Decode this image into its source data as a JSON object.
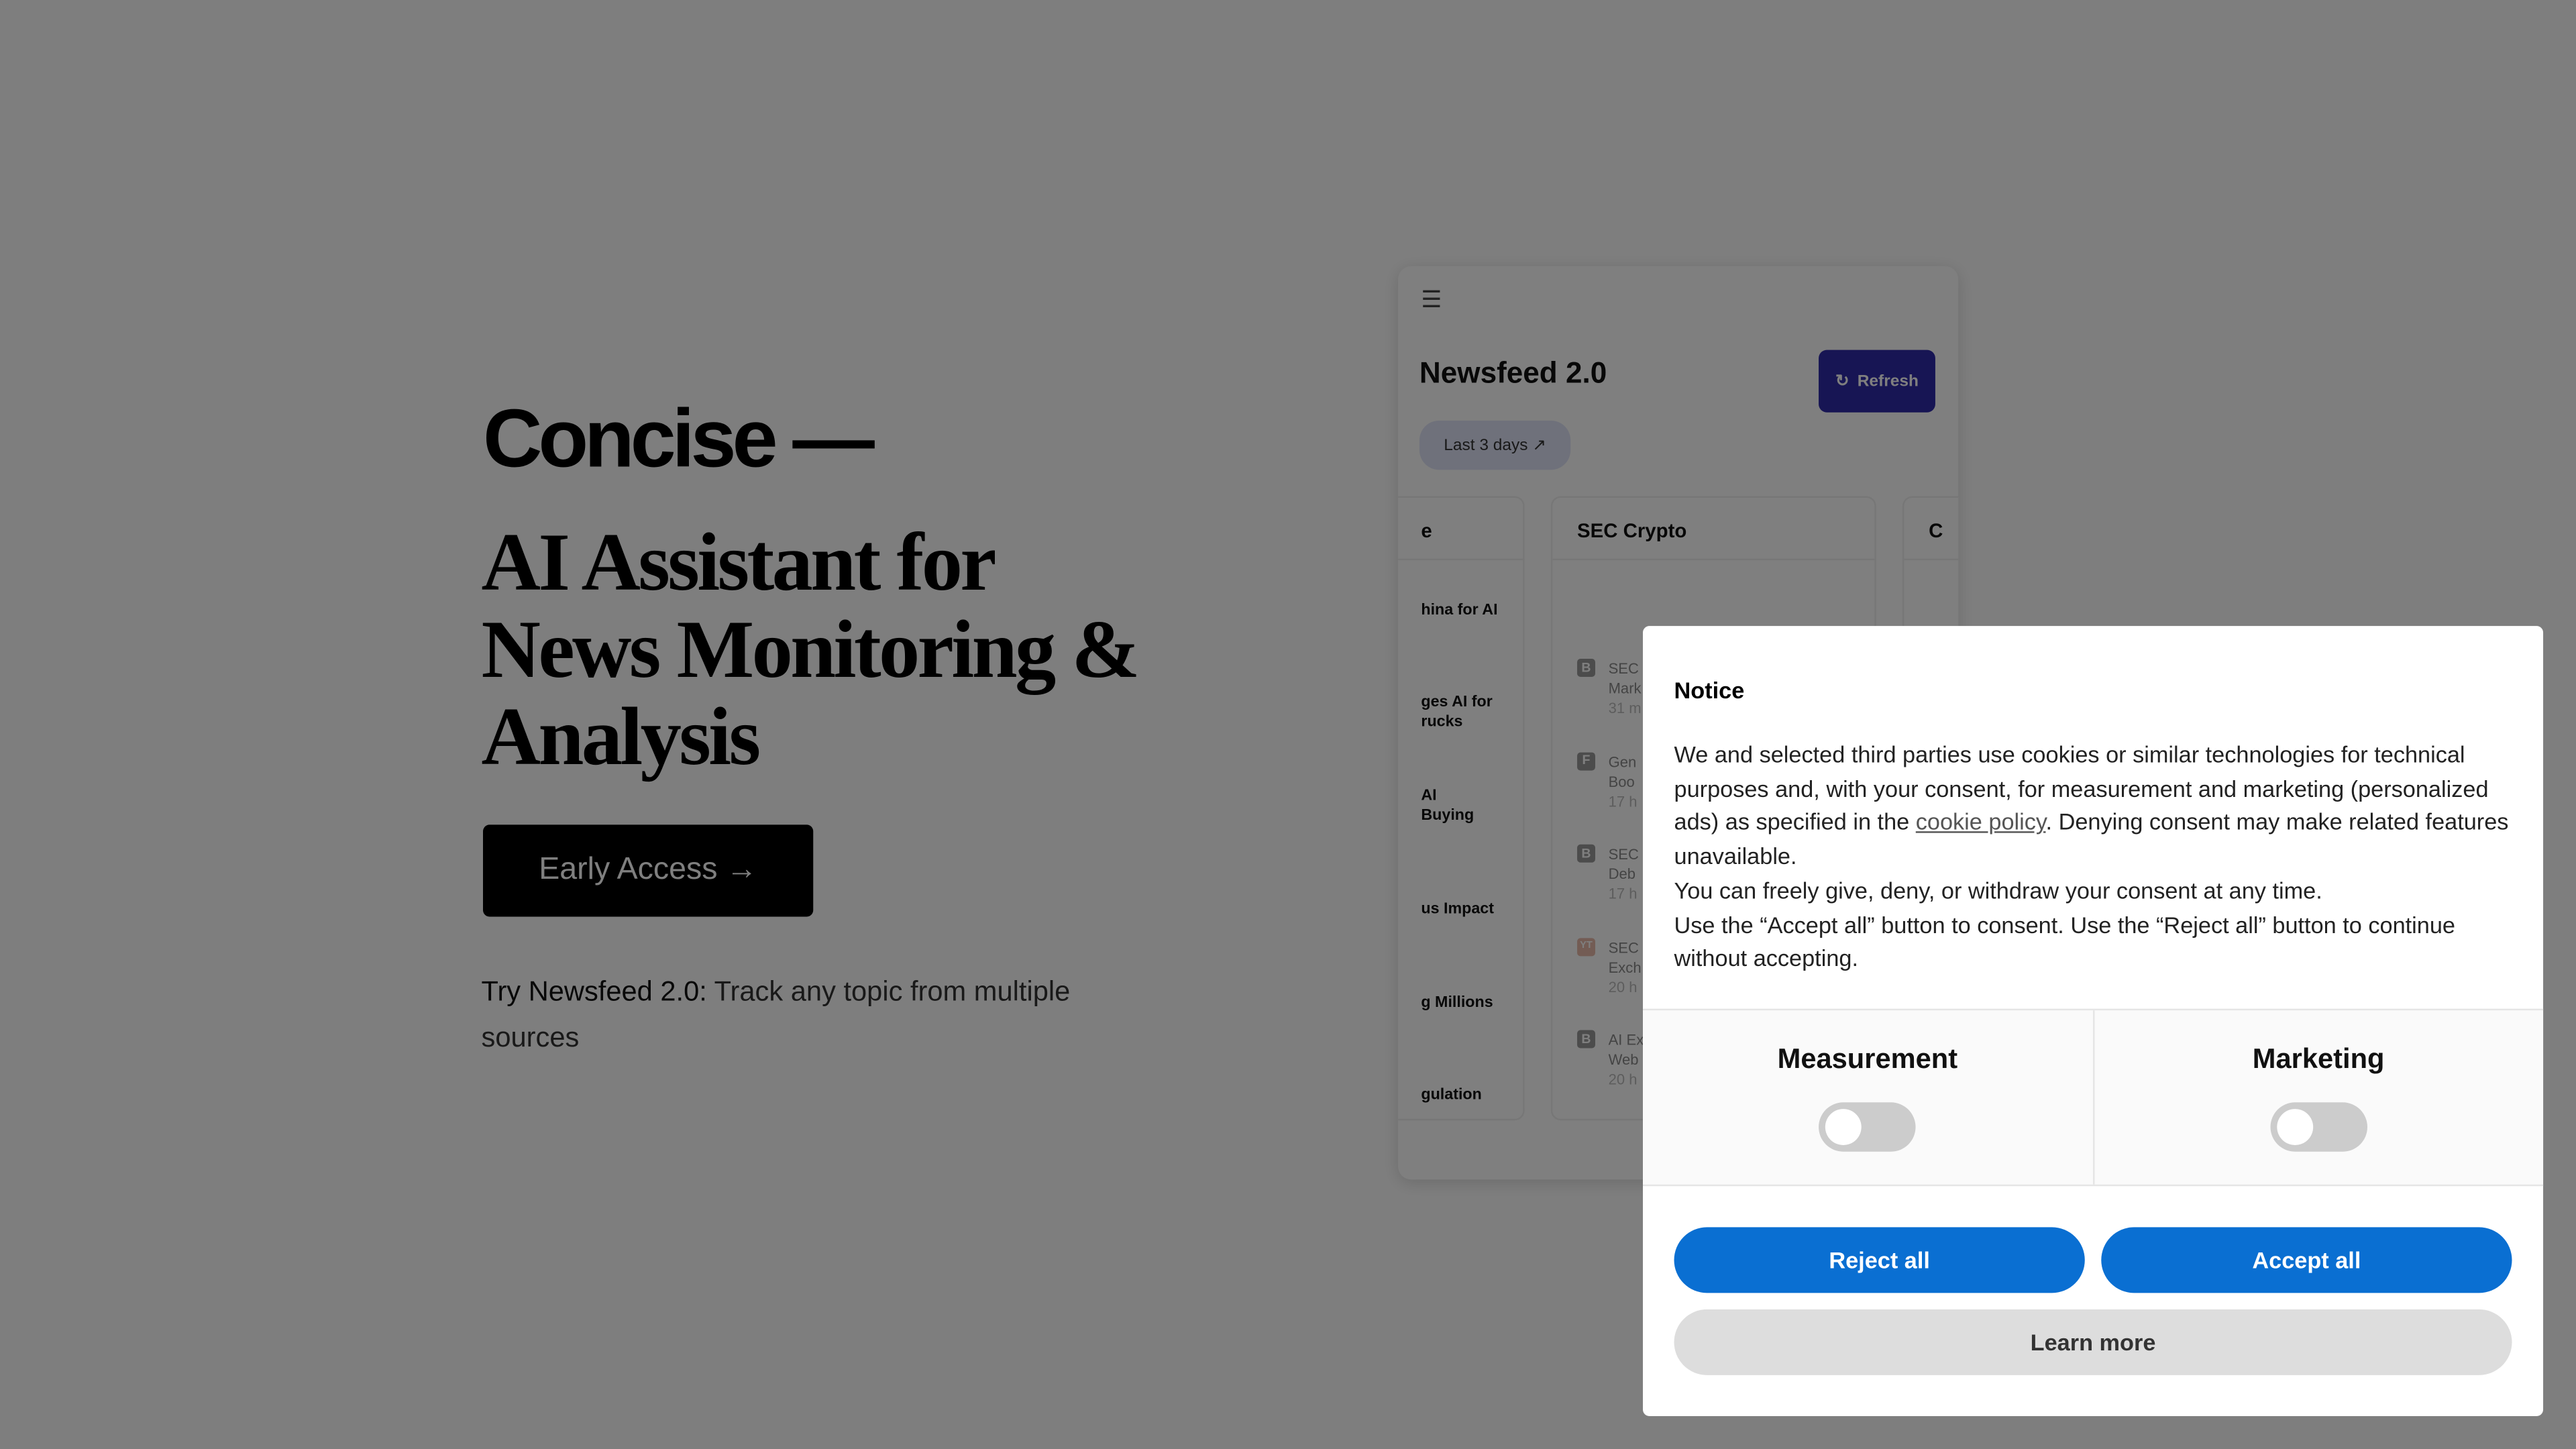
{
  "hero": {
    "brand": "Concise —",
    "headline": "AI Assistant for News Monitoring & Analysis",
    "cta": "Early Access →",
    "tagline_lead": "Try Newsfeed 2.0:",
    "tagline_rest": " Track any topic from multiple sources"
  },
  "preview": {
    "title": "Newsfeed 2.0",
    "refresh": "Refresh",
    "range": "Last 3 days ↗",
    "left_column": {
      "header": "e",
      "items": [
        "hina for AI",
        "ges AI for\nrucks",
        "AI\nBuying",
        "us Impact",
        "g Millions",
        "gulation"
      ]
    },
    "main_column": {
      "header": "SEC Crypto",
      "items": [
        {
          "badge": "B",
          "title": "SEC\nMark",
          "time": "31 m"
        },
        {
          "badge": "F",
          "title": "Gen\nBoo",
          "time": "17 h"
        },
        {
          "badge": "B",
          "title": "SEC\nDeb",
          "time": "17 h"
        },
        {
          "badge": "YT",
          "title": "SEC\nExch",
          "time": "20 h"
        },
        {
          "badge": "B",
          "title": "AI Ex\nWeb",
          "time": "20 h"
        }
      ]
    },
    "right_column": {
      "header": "C"
    }
  },
  "consent": {
    "title": "Notice",
    "p1_a": "We and selected third parties use cookies or similar technologies for technical purposes and, with your consent, for measurement and marketing (personalized ads) as specified in the ",
    "link": "cookie policy",
    "p1_b": ". Denying consent may make related features unavailable.",
    "p2": "You can freely give, deny, or withdraw your consent at any time.",
    "p3": "Use the “Accept all” button to consent. Use the “Reject all” button to continue without accepting.",
    "measurement": "Measurement",
    "marketing": "Marketing",
    "measurement_on": false,
    "marketing_on": false,
    "reject": "Reject all",
    "accept": "Accept all",
    "learn": "Learn more",
    "accent": "#0a6fd2"
  }
}
